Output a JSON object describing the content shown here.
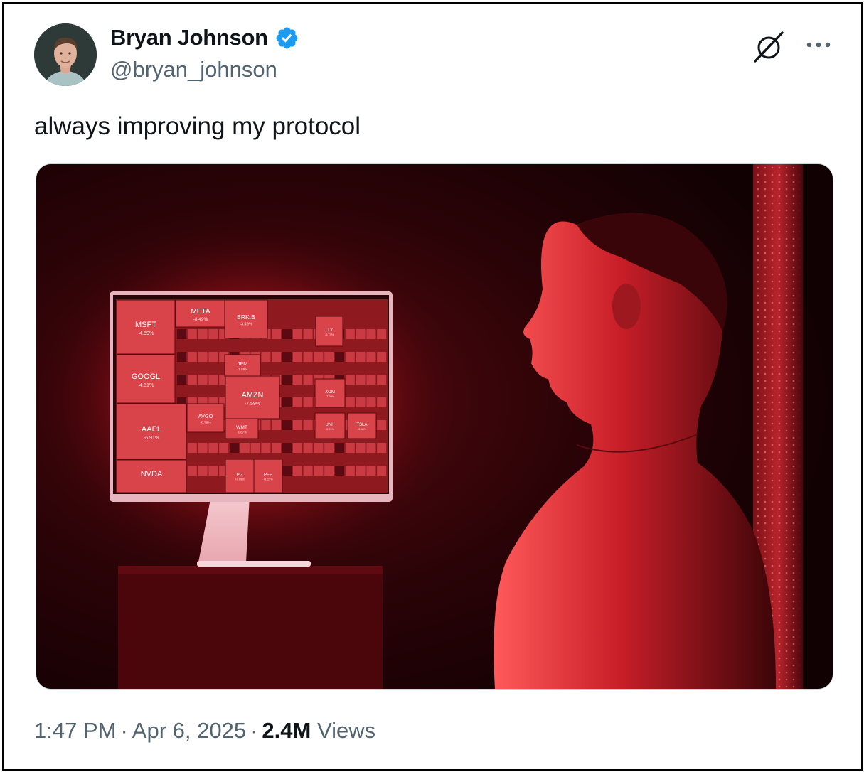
{
  "post": {
    "author": {
      "display_name": "Bryan Johnson",
      "handle": "@bryan_johnson",
      "verified": true,
      "avatar_icon": "profile-photo"
    },
    "text": "always improving my protocol",
    "timestamp": {
      "time": "1:47 PM",
      "separator": "·",
      "date": "Apr 6, 2025"
    },
    "views": {
      "count": "2.4M",
      "label": "Views"
    },
    "actions": {
      "grok_icon": "grok-icon",
      "more_icon": "more-icon"
    }
  },
  "media": {
    "kind": "photo",
    "screen_tiles": [
      {
        "ticker": "MSFT",
        "change": "-4.59%"
      },
      {
        "ticker": "GOOGL",
        "change": "-4.61%"
      },
      {
        "ticker": "AAPL",
        "change": "-6.91%"
      },
      {
        "ticker": "NVDA",
        "change": ""
      },
      {
        "ticker": "META",
        "change": "-8.49%"
      },
      {
        "ticker": "BRK.B",
        "change": "-3.49%"
      },
      {
        "ticker": "AMZN",
        "change": "-7.59%"
      },
      {
        "ticker": "LLY",
        "change": "-6.73%"
      },
      {
        "ticker": "JPM",
        "change": "-7.59%"
      },
      {
        "ticker": "XOM",
        "change": "-7.29%"
      },
      {
        "ticker": "AVGO",
        "change": "-8.79%"
      },
      {
        "ticker": "WMT",
        "change": "-1.87%"
      },
      {
        "ticker": "UNH",
        "change": "-5.76%"
      },
      {
        "ticker": "TSLA",
        "change": "-9.98%"
      },
      {
        "ticker": "PG",
        "change": "+0.09%"
      },
      {
        "ticker": "PEP",
        "change": "+1.17%"
      }
    ]
  },
  "colors": {
    "text_primary": "#0f1419",
    "text_secondary": "#536471",
    "verified_blue": "#1d9bf0",
    "tile_red": "#d9434a",
    "photo_background": "#1a0204"
  }
}
